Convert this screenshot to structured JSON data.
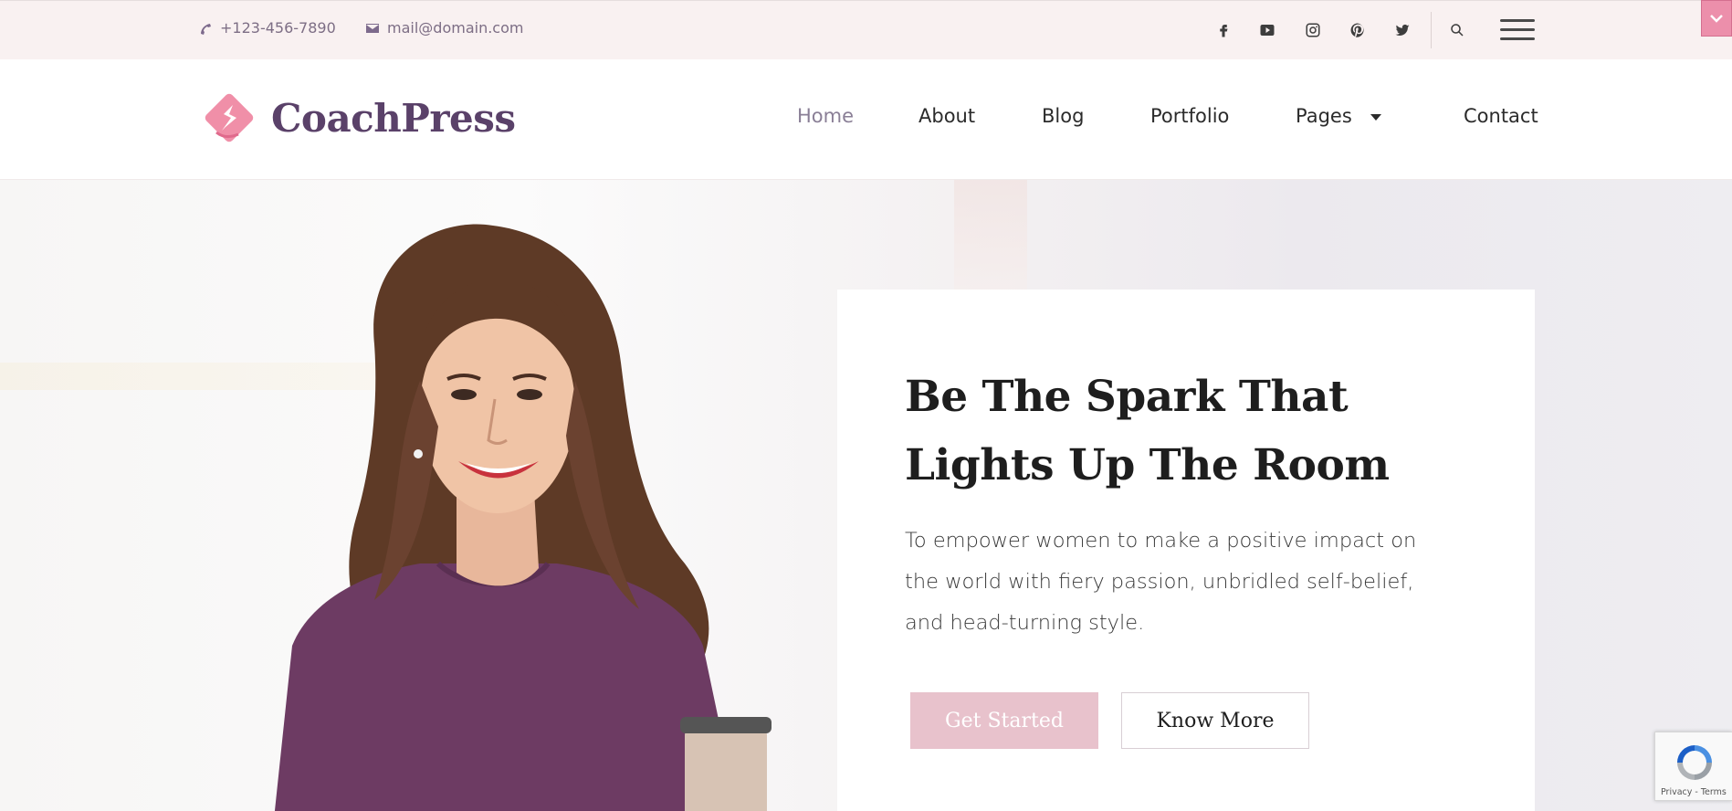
{
  "topbar": {
    "phone": "+123-456-7890",
    "email": "mail@domain.com",
    "social_icons": [
      "facebook-icon",
      "youtube-icon",
      "instagram-icon",
      "pinterest-icon",
      "twitter-icon"
    ],
    "search_icon": "search-icon",
    "menu_icon": "hamburger-menu-icon"
  },
  "header": {
    "logo_text": "CoachPress",
    "nav": [
      {
        "label": "Home",
        "active": true
      },
      {
        "label": "About"
      },
      {
        "label": "Blog"
      },
      {
        "label": "Portfolio"
      },
      {
        "label": "Pages",
        "has_dropdown": true
      },
      {
        "label": "Contact"
      }
    ]
  },
  "hero": {
    "title": "Be The Spark That Lights Up The Room",
    "description": "To empower women to make a positive impact on the world with fiery passion, unbridled self-belief, and head-turning style.",
    "primary_button": "Get Started",
    "secondary_button": "Know More"
  },
  "recaptcha": {
    "links": "Privacy - Terms"
  },
  "colors": {
    "topbar_bg": "#f9f1f1",
    "brand_purple": "#5a4169",
    "brand_pink": "#ec8fab",
    "button_pink": "#e8c2cc"
  }
}
